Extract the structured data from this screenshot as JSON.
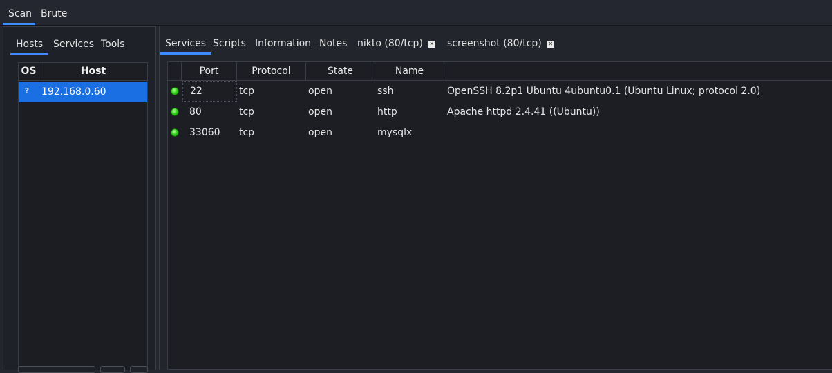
{
  "top_tabs": [
    {
      "label": "Scan",
      "active": true
    },
    {
      "label": "Brute",
      "active": false
    }
  ],
  "left_tabs": [
    {
      "label": "Hosts",
      "active": true
    },
    {
      "label": "Services",
      "active": false
    },
    {
      "label": "Tools",
      "active": false
    }
  ],
  "hosts_table": {
    "headers": {
      "os": "OS",
      "host": "Host"
    },
    "rows": [
      {
        "os_icon": "?",
        "host": "192.168.0.60",
        "selected": true
      }
    ]
  },
  "right_tabs": [
    {
      "label": "Services",
      "active": true
    },
    {
      "label": "Scripts",
      "active": false
    },
    {
      "label": "Information",
      "active": false
    },
    {
      "label": "Notes",
      "active": false
    },
    {
      "label": "nikto (80/tcp)",
      "closable": true
    },
    {
      "label": "screenshot (80/tcp)",
      "closable": true
    }
  ],
  "services_table": {
    "headers": {
      "port": "Port",
      "protocol": "Protocol",
      "state": "State",
      "name": "Name",
      "version": ""
    },
    "rows": [
      {
        "port": "22",
        "protocol": "tcp",
        "state": "open",
        "name": "ssh",
        "version": "OpenSSH 8.2p1 Ubuntu 4ubuntu0.1 (Ubuntu Linux; protocol 2.0)",
        "status": "open-icon"
      },
      {
        "port": "80",
        "protocol": "tcp",
        "state": "open",
        "name": "http",
        "version": "Apache httpd 2.4.41 ((Ubuntu))",
        "status": "open-icon"
      },
      {
        "port": "33060",
        "protocol": "tcp",
        "state": "open",
        "name": "mysqlx",
        "version": "",
        "status": "open-icon"
      }
    ]
  },
  "colors": {
    "accent": "#3d8bfd",
    "selection": "#1a6fe3",
    "background": "#24272f",
    "status_open": "#34d61c"
  }
}
